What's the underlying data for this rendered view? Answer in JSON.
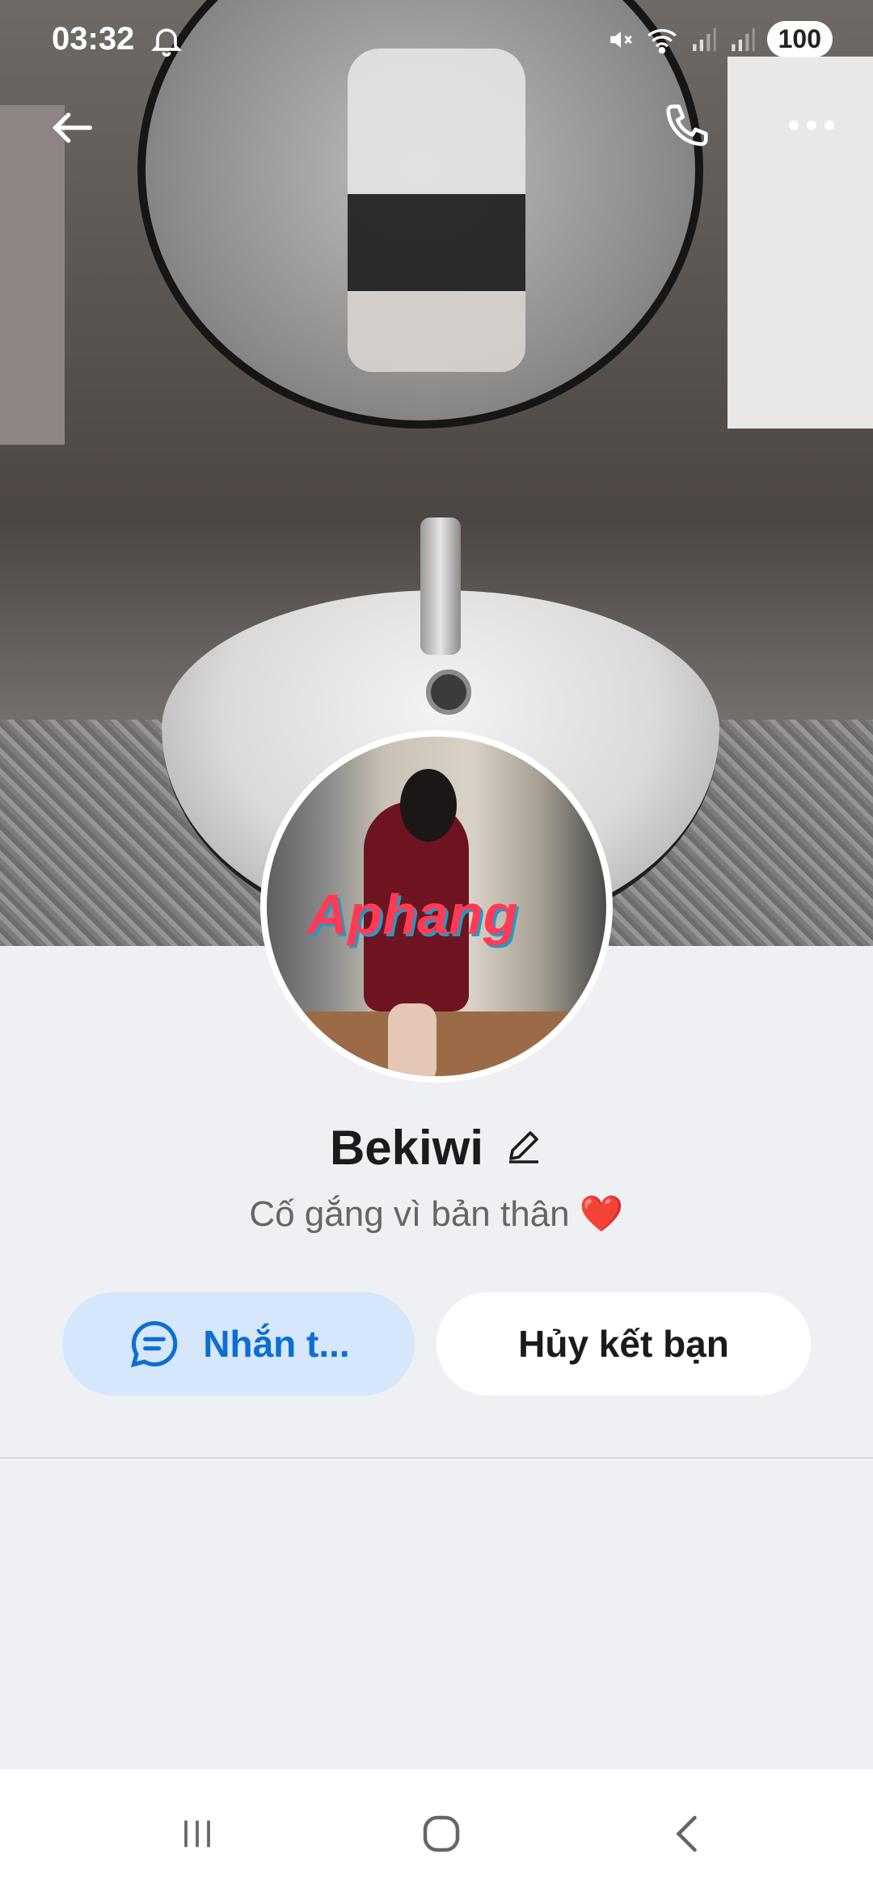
{
  "status_bar": {
    "time": "03:32",
    "battery": "100"
  },
  "profile": {
    "name": "Bekiwi",
    "status": "Cố gắng vì bản thân",
    "status_emoji": "❤️",
    "avatar_watermark": "Aphang"
  },
  "actions": {
    "message_label": "Nhắn t...",
    "unfriend_label": "Hủy kết bạn"
  },
  "icons": {
    "back": "back-arrow-icon",
    "call": "phone-icon",
    "more": "more-icon",
    "edit": "pencil-icon",
    "message": "chat-bubble-icon"
  },
  "colors": {
    "accent": "#0b6fd1",
    "message_button_bg": "#d6e6fb",
    "page_bg": "#eff0f4"
  }
}
